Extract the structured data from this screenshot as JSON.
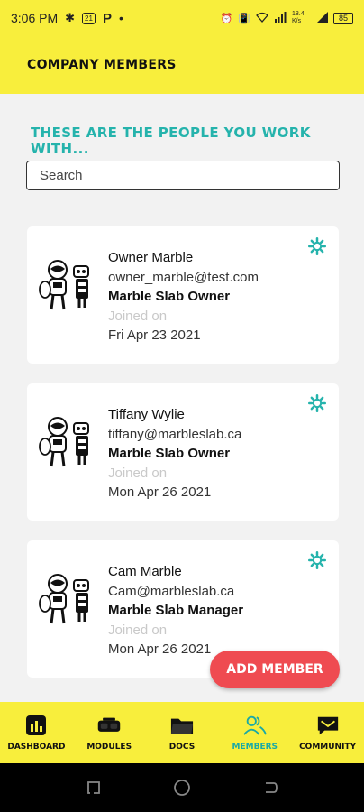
{
  "status_bar": {
    "time": "3:06 PM",
    "icons_left": [
      "slack-icon",
      "calendar-icon",
      "parking-icon",
      "dot-icon"
    ],
    "calendar_label": "21",
    "p_label": "P",
    "dot": "•",
    "network_speed": "18.4 K/s",
    "battery": "85"
  },
  "header": {
    "title": "COMPANY MEMBERS"
  },
  "subtitle": "THESE ARE THE PEOPLE YOU WORK WITH...",
  "search": {
    "placeholder": "Search",
    "value": ""
  },
  "members": [
    {
      "name": "Owner Marble",
      "email": "owner_marble@test.com",
      "role": "Marble Slab Owner",
      "joined_label": "Joined on",
      "joined_date": "Fri Apr 23 2021"
    },
    {
      "name": "Tiffany Wylie",
      "email": "tiffany@marbleslab.ca",
      "role": "Marble Slab Owner",
      "joined_label": "Joined on",
      "joined_date": "Mon Apr 26 2021"
    },
    {
      "name": "Cam Marble",
      "email": "Cam@marbleslab.ca",
      "role": "Marble Slab Manager",
      "joined_label": "Joined on",
      "joined_date": "Mon Apr 26 2021"
    }
  ],
  "add_member_label": "ADD MEMBER",
  "nav": {
    "items": [
      {
        "label": "DASHBOARD",
        "icon": "dashboard-icon"
      },
      {
        "label": "MODULES",
        "icon": "vr-headset-icon"
      },
      {
        "label": "DOCS",
        "icon": "folder-icon"
      },
      {
        "label": "MEMBERS",
        "icon": "members-icon",
        "active": true
      },
      {
        "label": "COMMUNITY",
        "icon": "community-icon"
      }
    ]
  },
  "colors": {
    "brand_yellow": "#f8ee3c",
    "accent_teal": "#25b3ac",
    "add_button_red": "#ef4b51"
  }
}
